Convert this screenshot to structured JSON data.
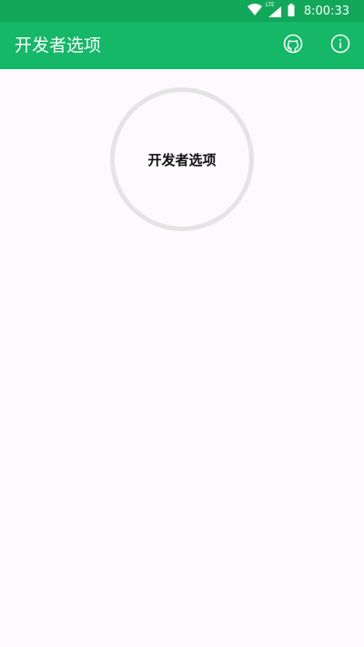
{
  "status_bar": {
    "time": "8:00:33",
    "network_label": "LTE",
    "icons": [
      "wifi-icon",
      "cellular-signal-icon",
      "battery-icon"
    ]
  },
  "app_bar": {
    "title": "开发者选项",
    "actions": [
      "github-icon",
      "info-icon"
    ]
  },
  "main": {
    "toggle_label": "开发者选项"
  },
  "colors": {
    "status_bar": "#11a85a",
    "app_bar": "#14b866",
    "background": "#fdfafd",
    "ring": "#e4e4e4"
  }
}
